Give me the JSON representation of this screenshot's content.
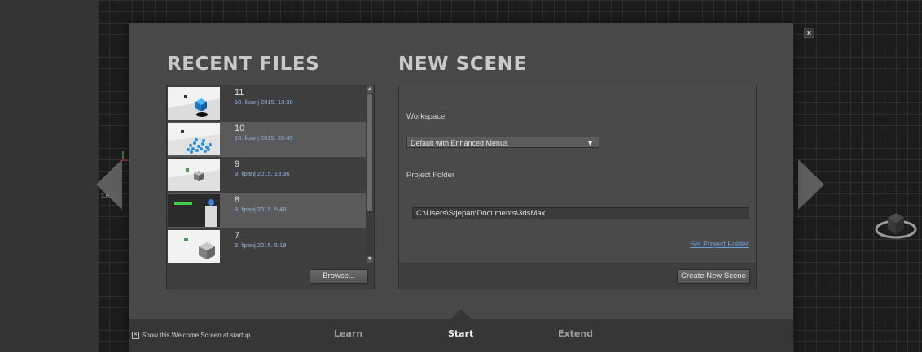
{
  "viewport": {
    "label": "Le"
  },
  "recent_files": {
    "title": "RECENT FILES",
    "items": [
      {
        "name": "11",
        "date": "10. lipanj 2015. 13:38",
        "thumbnail": "blue-cube-thumbnail"
      },
      {
        "name": "10",
        "date": "10. lipanj 2015. 20:45",
        "thumbnail": "blue-particles-thumbnail"
      },
      {
        "name": "9",
        "date": "9. lipanj 2015. 13:36",
        "thumbnail": "grey-cube-thumbnail"
      },
      {
        "name": "8",
        "date": "8. lipanj 2015. 5:48",
        "thumbnail": "green-bar-thumbnail"
      },
      {
        "name": "7",
        "date": "8. lipanj 2015. 5:19",
        "thumbnail": "grey-box-thumbnail"
      }
    ],
    "browse_label": "Browse..."
  },
  "new_scene": {
    "title": "NEW SCENE",
    "workspace_label": "Workspace",
    "workspace_value": "Default with Enhanced Menus",
    "project_folder_label": "Project Folder",
    "project_folder_path": "C:\\Users\\Stjepan\\Documents\\3dsMax",
    "set_project_folder_label": "Set Project Folder",
    "create_label": "Create New Scene"
  },
  "footer": {
    "show_at_startup_label": "Show this Welcome Screen at startup",
    "show_at_startup_checked": true,
    "tabs": [
      {
        "label": "Learn",
        "active": false
      },
      {
        "label": "Start",
        "active": true
      },
      {
        "label": "Extend",
        "active": false
      }
    ]
  },
  "close_label": "x",
  "colors": {
    "dialog_bg": "#484848",
    "accent_link": "#6f9fd8",
    "date_text": "#8fb3d9",
    "selected_row": "#5a5a5a"
  }
}
